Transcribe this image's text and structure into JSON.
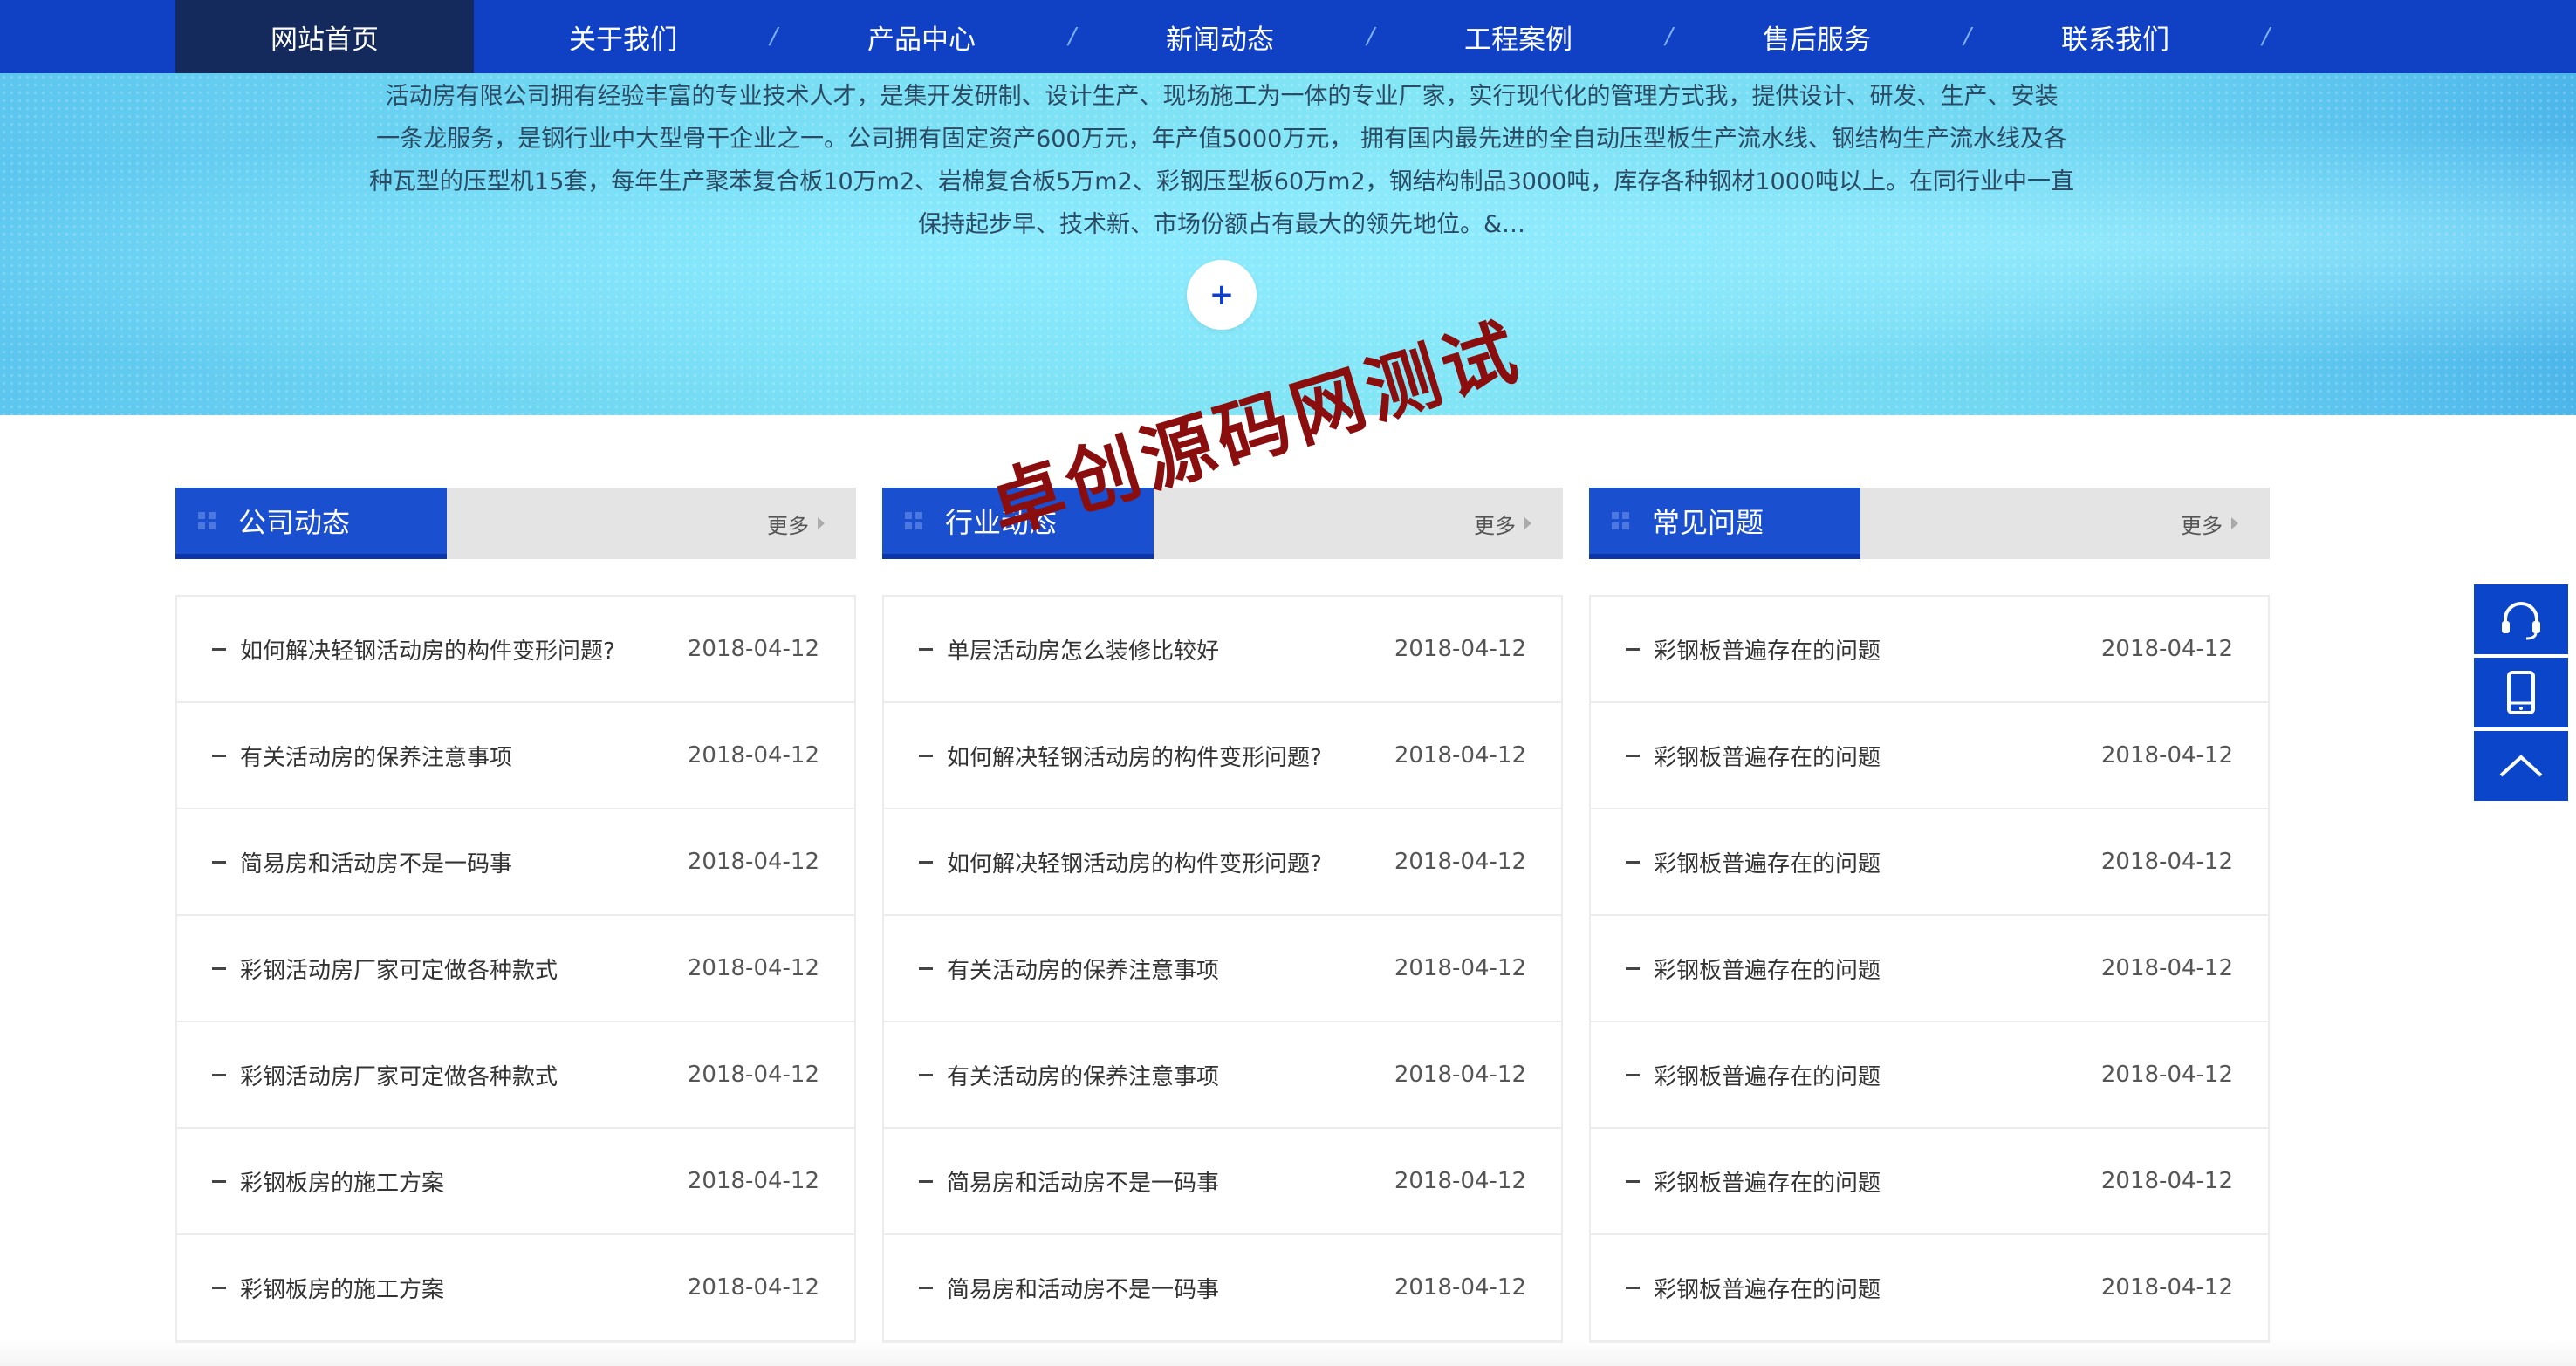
{
  "nav": {
    "items": [
      {
        "label": "网站首页",
        "active": true
      },
      {
        "label": "关于我们"
      },
      {
        "label": "产品中心"
      },
      {
        "label": "新闻动态"
      },
      {
        "label": "工程案例"
      },
      {
        "label": "售后服务"
      },
      {
        "label": "联系我们"
      }
    ],
    "separator": "/"
  },
  "hero": {
    "lines": [
      "活动房有限公司拥有经验丰富的专业技术人才，是集开发研制、设计生产、现场施工为一体的专业厂家，实行现代化的管理方式我，提供设计、研发、生产、安装",
      "一条龙服务，是钢行业中大型骨干企业之一。公司拥有固定资产600万元，年产值5000万元， 拥有国内最先进的全自动压型板生产流水线、钢结构生产流水线及各",
      "种瓦型的压型机15套，每年生产聚苯复合板10万m2、岩棉复合板5万m2、彩钢压型板60万m2，钢结构制品3000吨，库存各种钢材1000吨以上。在同行业中一直",
      "保持起步早、技术新、市场份额占有最大的领先地位。&…"
    ],
    "plus_label": "+"
  },
  "watermark": "卓创源码网测试",
  "more_label": "更多",
  "columns": [
    {
      "title": "公司动态",
      "rows": [
        {
          "title": "如何解决轻钢活动房的构件变形问题?",
          "date": "2018-04-12"
        },
        {
          "title": "有关活动房的保养注意事项",
          "date": "2018-04-12"
        },
        {
          "title": "简易房和活动房不是一码事",
          "date": "2018-04-12"
        },
        {
          "title": "彩钢活动房厂家可定做各种款式",
          "date": "2018-04-12"
        },
        {
          "title": "彩钢活动房厂家可定做各种款式",
          "date": "2018-04-12"
        },
        {
          "title": "彩钢板房的施工方案",
          "date": "2018-04-12"
        },
        {
          "title": "彩钢板房的施工方案",
          "date": "2018-04-12"
        }
      ]
    },
    {
      "title": "行业动态",
      "rows": [
        {
          "title": "单层活动房怎么装修比较好",
          "date": "2018-04-12"
        },
        {
          "title": "如何解决轻钢活动房的构件变形问题?",
          "date": "2018-04-12"
        },
        {
          "title": "如何解决轻钢活动房的构件变形问题?",
          "date": "2018-04-12"
        },
        {
          "title": "有关活动房的保养注意事项",
          "date": "2018-04-12"
        },
        {
          "title": "有关活动房的保养注意事项",
          "date": "2018-04-12"
        },
        {
          "title": "简易房和活动房不是一码事",
          "date": "2018-04-12"
        },
        {
          "title": "简易房和活动房不是一码事",
          "date": "2018-04-12"
        }
      ]
    },
    {
      "title": "常见问题",
      "rows": [
        {
          "title": "彩钢板普遍存在的问题",
          "date": "2018-04-12"
        },
        {
          "title": "彩钢板普遍存在的问题",
          "date": "2018-04-12"
        },
        {
          "title": "彩钢板普遍存在的问题",
          "date": "2018-04-12"
        },
        {
          "title": "彩钢板普遍存在的问题",
          "date": "2018-04-12"
        },
        {
          "title": "彩钢板普遍存在的问题",
          "date": "2018-04-12"
        },
        {
          "title": "彩钢板普遍存在的问题",
          "date": "2018-04-12"
        },
        {
          "title": "彩钢板普遍存在的问题",
          "date": "2018-04-12"
        }
      ]
    }
  ],
  "side_toolbar": {
    "buttons": [
      {
        "icon": "headset-icon"
      },
      {
        "icon": "mobile-phone-icon"
      },
      {
        "icon": "chevron-up-icon"
      }
    ]
  },
  "colors": {
    "nav_bg": "#1040c4",
    "nav_active": "#152a5c",
    "tab_blue": "#1a4fd0",
    "side_blue": "#0b45c9",
    "watermark": "#8a0e0e"
  }
}
